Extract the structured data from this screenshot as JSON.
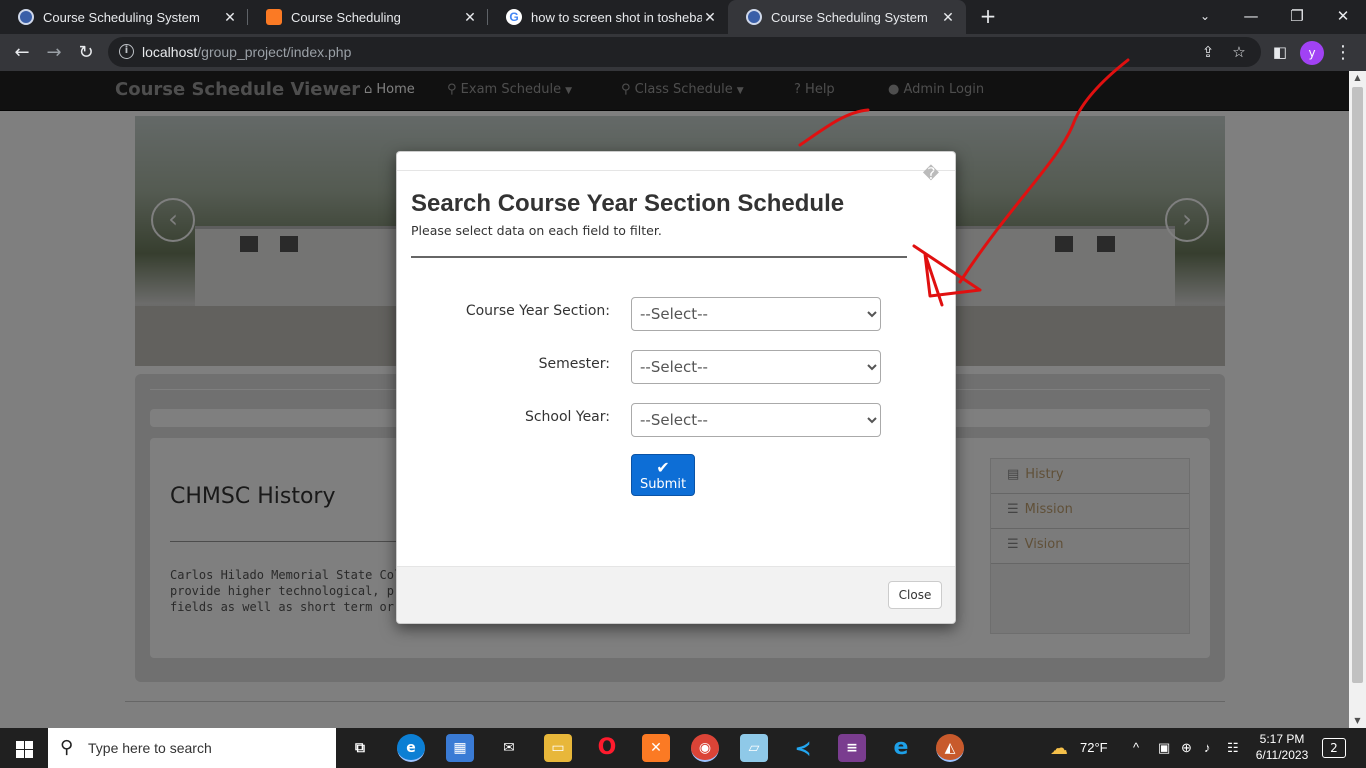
{
  "browser": {
    "tabs": [
      {
        "title": "Course Scheduling System",
        "favicon_color": "#3a5fa8"
      },
      {
        "title": "Course Scheduling",
        "favicon_color": "#fb7a24"
      },
      {
        "title": "how to screen shot in tosheba pc",
        "favicon_color": "#4285f4"
      },
      {
        "title": "Course Scheduling System",
        "favicon_color": "#3a5fa8"
      }
    ],
    "new_tab_symbol": "+",
    "close_symbol": "✕",
    "url_host": "localhost",
    "url_path": "/group_project/index.php",
    "profile_initial": "y",
    "window_controls": {
      "minimize": "—",
      "restore": "❐",
      "close": "✕"
    }
  },
  "site": {
    "brand": "Course Schedule Viewer",
    "nav": [
      {
        "icon": "home-icon",
        "glyph": "⌂",
        "label": "Home",
        "dropdown": false
      },
      {
        "icon": "search-icon",
        "glyph": "⚲",
        "label": "Exam Schedule",
        "dropdown": true
      },
      {
        "icon": "search-icon",
        "glyph": "⚲",
        "label": "Class Schedule",
        "dropdown": true
      },
      {
        "icon": "question-circle-icon",
        "glyph": "?",
        "label": "Help",
        "dropdown": false
      },
      {
        "icon": "user-icon",
        "glyph": "●",
        "label": "Admin Login",
        "dropdown": false
      }
    ],
    "history_title": "CHMSC History",
    "history_text": [
      "Carlos Hilado Memorial State College",
      "provide higher technological, profes",
      "fields as well as short term or vocat"
    ],
    "side_menu": [
      {
        "icon": "book-icon",
        "label": "Histry"
      },
      {
        "icon": "list-icon",
        "label": "Mission"
      },
      {
        "icon": "list-icon",
        "label": "Vision"
      }
    ]
  },
  "modal": {
    "close_x": "�",
    "title": "Search Course Year Section Schedule",
    "subtitle": "Please select data on each field to filter.",
    "fields": [
      {
        "label": "Course Year Section:",
        "value": "--Select--"
      },
      {
        "label": "Semester:",
        "value": "--Select--"
      },
      {
        "label": "School Year:",
        "value": "--Select--"
      }
    ],
    "submit_label": "Submit",
    "close_label": "Close"
  },
  "taskbar": {
    "search_placeholder": "Type here to search",
    "weather": "72°F",
    "time": "5:17 PM",
    "date": "6/11/2023",
    "notification_count": "2"
  },
  "colors": {
    "annotation": "#e01010",
    "submit": "#0d6ed6",
    "navbar": "#222222"
  }
}
